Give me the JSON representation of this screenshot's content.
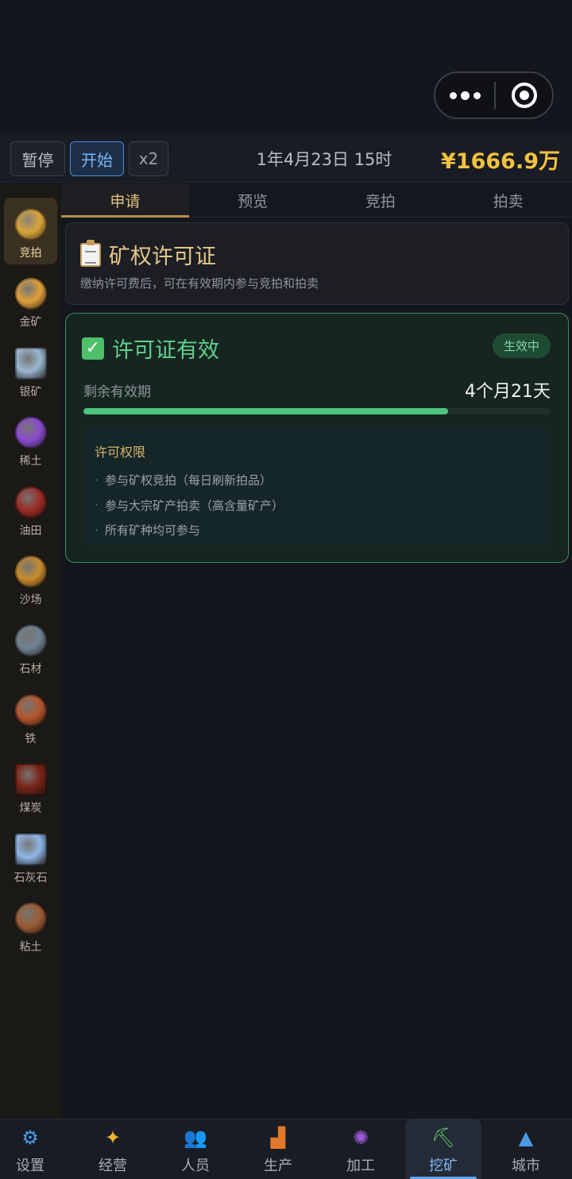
{
  "toolbar": {
    "pause_label": "暂停",
    "start_label": "开始",
    "speed_label": "x2",
    "date_text": "1年4月23日 15时",
    "money_text": "¥1666.9万"
  },
  "sidebar": {
    "items": [
      {
        "label": "竞拍",
        "icon": "auction-icon",
        "color": "#d9a53a"
      },
      {
        "label": "金矿",
        "icon": "gold-ore-icon",
        "color": "#e0a03a"
      },
      {
        "label": "银矿",
        "icon": "silver-ore-icon",
        "color": "#9bb7d2"
      },
      {
        "label": "稀土",
        "icon": "rare-earth-icon",
        "color": "#8a4ad1"
      },
      {
        "label": "油田",
        "icon": "oil-field-icon",
        "color": "#9a2a24"
      },
      {
        "label": "沙场",
        "icon": "sand-field-icon",
        "color": "#c98a2a"
      },
      {
        "label": "石材",
        "icon": "stone-icon",
        "color": "#6f8190"
      },
      {
        "label": "铁",
        "icon": "iron-icon",
        "color": "#b4542c"
      },
      {
        "label": "煤炭",
        "icon": "coal-icon",
        "color": "#7a2418"
      },
      {
        "label": "石灰石",
        "icon": "limestone-icon",
        "color": "#8fb6e8"
      },
      {
        "label": "粘土",
        "icon": "clay-icon",
        "color": "#9a5a34"
      }
    ]
  },
  "tabs": [
    {
      "label": "申请"
    },
    {
      "label": "预览"
    },
    {
      "label": "竞拍"
    },
    {
      "label": "拍卖"
    }
  ],
  "license": {
    "title": "矿权许可证",
    "description": "缴纳许可费后，可在有效期内参与竞拍和拍卖"
  },
  "status": {
    "title": "许可证有效",
    "badge": "生效中",
    "remaining_label": "剩余有效期",
    "remaining_value": "4个月21天",
    "progress_fraction": 0.78,
    "permissions_title": "许可权限",
    "permissions": [
      "参与矿权竞拍（每日刷新拍品）",
      "参与大宗矿产拍卖（高含量矿产）",
      "所有矿种均可参与"
    ]
  },
  "bottom_nav": [
    {
      "label": "设置",
      "icon": "gear-icon",
      "glyph": "⚙",
      "color": "#3fa3f0"
    },
    {
      "label": "经营",
      "icon": "business-icon",
      "glyph": "✦",
      "color": "#f0b62a"
    },
    {
      "label": "人员",
      "icon": "people-icon",
      "glyph": "👥",
      "color": "#4fb8f0"
    },
    {
      "label": "生产",
      "icon": "factory-icon",
      "glyph": "▟",
      "color": "#e07a2a"
    },
    {
      "label": "加工",
      "icon": "processing-icon",
      "glyph": "✺",
      "color": "#9a5ad8"
    },
    {
      "label": "挖矿",
      "icon": "pickaxe-icon",
      "glyph": "⛏",
      "color": "#5cc46a"
    },
    {
      "label": "城市",
      "icon": "city-icon",
      "glyph": "▲",
      "color": "#4a9ae8"
    }
  ]
}
